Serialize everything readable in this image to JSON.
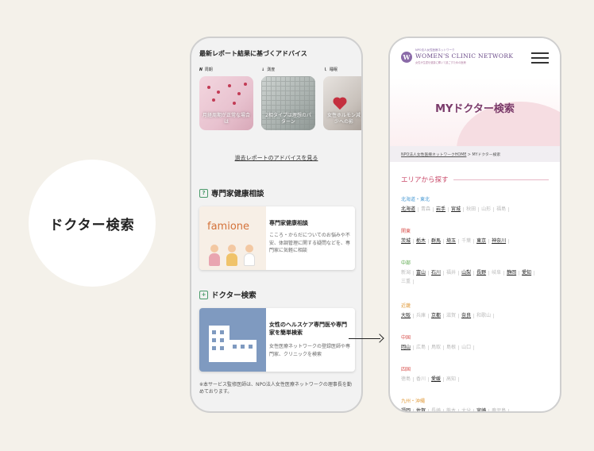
{
  "label": "ドクター検索",
  "phone1": {
    "advice_title": "最新レポート結果に基づくアドバイス",
    "categories": [
      {
        "icon": "𝑵",
        "label": "周期"
      },
      {
        "icon": "↓",
        "label": "測度"
      },
      {
        "icon": "ｌ",
        "label": "睡眠"
      }
    ],
    "thumbs": [
      {
        "caption": "月経周期が正常な場合は"
      },
      {
        "caption": "2相タイプは理想のパターン"
      },
      {
        "caption": "女性ホルモン減少への影"
      }
    ],
    "past_link": "過去レポートのアドバイスを見る",
    "consult": {
      "heading": "専門家健康相談",
      "heading_icon": "?",
      "brand": "famione",
      "title": "専門家健康相談",
      "body": "こころ・からだについてのお悩みや不安、体調管理に関する疑問などを、専門家に気軽に相談"
    },
    "doctor": {
      "heading": "ドクター検索",
      "heading_icon": "+",
      "title": "女性のヘルスケア専門医や専門家を簡単検索",
      "body": "女性医療ネットワークの登録医師や専門家、クリニックを検索"
    },
    "note": "※本サービス監修医師は、NPO法人女性医療ネットワークの理事長を勤めております。"
  },
  "phone2": {
    "logo_small": "NPO法人女性医療ネットワーク",
    "logo_main": "WOMEN'S CLINIC NETWORK",
    "logo_sub": "女性が生涯を健康に輝いて過ごすための医療",
    "hero_title": "MYドクター検索",
    "breadcrumb_home": "NPO法人女性医療ネットワークHOME",
    "breadcrumb_sep": " > ",
    "breadcrumb_current": "MYドクター検索",
    "area_heading": "エリアから探す",
    "regions": [
      {
        "name": "北海道・東北",
        "color": "#4a9ad4",
        "prefs": [
          {
            "n": "北海道",
            "on": true
          },
          {
            "n": "青森",
            "on": false
          },
          {
            "n": "岩手",
            "on": true
          },
          {
            "n": "宮城",
            "on": true
          },
          {
            "n": "秋田",
            "on": false
          },
          {
            "n": "山形",
            "on": false
          },
          {
            "n": "福島",
            "on": false
          }
        ]
      },
      {
        "name": "関東",
        "color": "#d9534f",
        "prefs": [
          {
            "n": "茨城",
            "on": true
          },
          {
            "n": "栃木",
            "on": true
          },
          {
            "n": "群馬",
            "on": true
          },
          {
            "n": "埼玉",
            "on": true
          },
          {
            "n": "千葉",
            "on": false
          },
          {
            "n": "東京",
            "on": true
          },
          {
            "n": "神奈川",
            "on": true
          }
        ]
      },
      {
        "name": "中部",
        "color": "#5aa84a",
        "prefs": [
          {
            "n": "新潟",
            "on": false
          },
          {
            "n": "富山",
            "on": true
          },
          {
            "n": "石川",
            "on": true
          },
          {
            "n": "福井",
            "on": false
          },
          {
            "n": "山梨",
            "on": true
          },
          {
            "n": "長野",
            "on": true
          },
          {
            "n": "岐阜",
            "on": false
          },
          {
            "n": "静岡",
            "on": true
          },
          {
            "n": "愛知",
            "on": true
          },
          {
            "n": "三重",
            "on": false
          }
        ]
      },
      {
        "name": "近畿",
        "color": "#e09a3a",
        "prefs": [
          {
            "n": "大阪",
            "on": true
          },
          {
            "n": "兵庫",
            "on": false
          },
          {
            "n": "京都",
            "on": true
          },
          {
            "n": "滋賀",
            "on": false
          },
          {
            "n": "奈良",
            "on": true
          },
          {
            "n": "和歌山",
            "on": false
          }
        ]
      },
      {
        "name": "中国",
        "color": "#d9534f",
        "prefs": [
          {
            "n": "岡山",
            "on": true
          },
          {
            "n": "広島",
            "on": false
          },
          {
            "n": "鳥取",
            "on": false
          },
          {
            "n": "島根",
            "on": false
          },
          {
            "n": "山口",
            "on": false
          }
        ]
      },
      {
        "name": "四国",
        "color": "#d9534f",
        "prefs": [
          {
            "n": "徳島",
            "on": false
          },
          {
            "n": "香川",
            "on": false
          },
          {
            "n": "愛媛",
            "on": true
          },
          {
            "n": "高知",
            "on": false
          }
        ]
      },
      {
        "name": "九州・沖縄",
        "color": "#e09a3a",
        "prefs": [
          {
            "n": "福岡",
            "on": true
          },
          {
            "n": "佐賀",
            "on": true
          },
          {
            "n": "長崎",
            "on": false
          },
          {
            "n": "熊本",
            "on": false
          },
          {
            "n": "大分",
            "on": false
          },
          {
            "n": "宮崎",
            "on": true
          },
          {
            "n": "鹿児島",
            "on": false
          }
        ]
      }
    ]
  }
}
